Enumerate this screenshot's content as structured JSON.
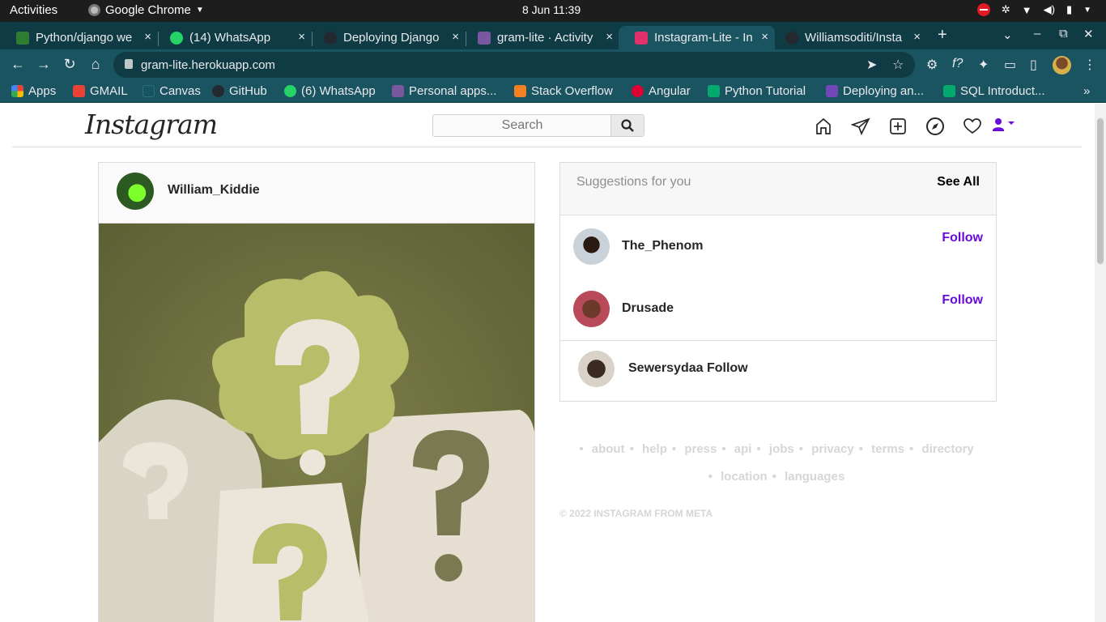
{
  "system": {
    "activities": "Activities",
    "app_name": "Google Chrome",
    "clock": "8 Jun  11:39"
  },
  "tabs": [
    {
      "title": "Python/django we",
      "favicon_color": "#2e7d32",
      "close": "×"
    },
    {
      "title": "(14) WhatsApp",
      "favicon_color": "#25d366",
      "close": "×"
    },
    {
      "title": "Deploying Django",
      "favicon_color": "#24292f",
      "close": "×"
    },
    {
      "title": "gram-lite · Activity",
      "favicon_color": "#79589f",
      "close": "×"
    },
    {
      "title": "Instagram-Lite - In",
      "favicon_color": "#e1306c",
      "close": "×"
    },
    {
      "title": "Williamsoditi/Insta",
      "favicon_color": "#24292f",
      "close": "×"
    }
  ],
  "toolbar": {
    "url": "gram-lite.herokuapp.com",
    "new_tab": "+"
  },
  "bookmarks": [
    {
      "label": "Apps",
      "color": "#e94235"
    },
    {
      "label": "GMAIL",
      "color": "#ea4335"
    },
    {
      "label": "Canvas",
      "color": "#1a5461"
    },
    {
      "label": "GitHub",
      "color": "#24292f"
    },
    {
      "label": "(6) WhatsApp",
      "color": "#25d366"
    },
    {
      "label": "Personal apps...",
      "color": "#79589f"
    },
    {
      "label": "Stack Overflow",
      "color": "#f48024"
    },
    {
      "label": "Angular",
      "color": "#dd0031"
    },
    {
      "label": "Python Tutorial",
      "color": "#04aa6d"
    },
    {
      "label": "Deploying an...",
      "color": "#7248b9"
    },
    {
      "label": "SQL Introduct...",
      "color": "#04aa6d"
    }
  ],
  "instagram": {
    "logo": "Instagram",
    "search_placeholder": "Search",
    "post": {
      "username": "William_Kiddie"
    },
    "suggestions": {
      "title": "Suggestions for you",
      "see_all": "See All",
      "items": [
        {
          "username": "The_Phenom",
          "follow": "Follow"
        },
        {
          "username": "Drusade",
          "follow": "Follow"
        },
        {
          "username": "Sewersydaa Follow"
        }
      ]
    },
    "footer_links": [
      "about",
      "help",
      "press",
      "api",
      "jobs",
      "privacy",
      "terms",
      "directory",
      "location",
      "languages"
    ],
    "copyright": "© 2022 INSTAGRAM FROM META"
  },
  "colors": {
    "accent_follow": "#6b0bd9",
    "chrome_frame": "#1a5461",
    "chrome_tabstrip": "#0f3b45"
  }
}
